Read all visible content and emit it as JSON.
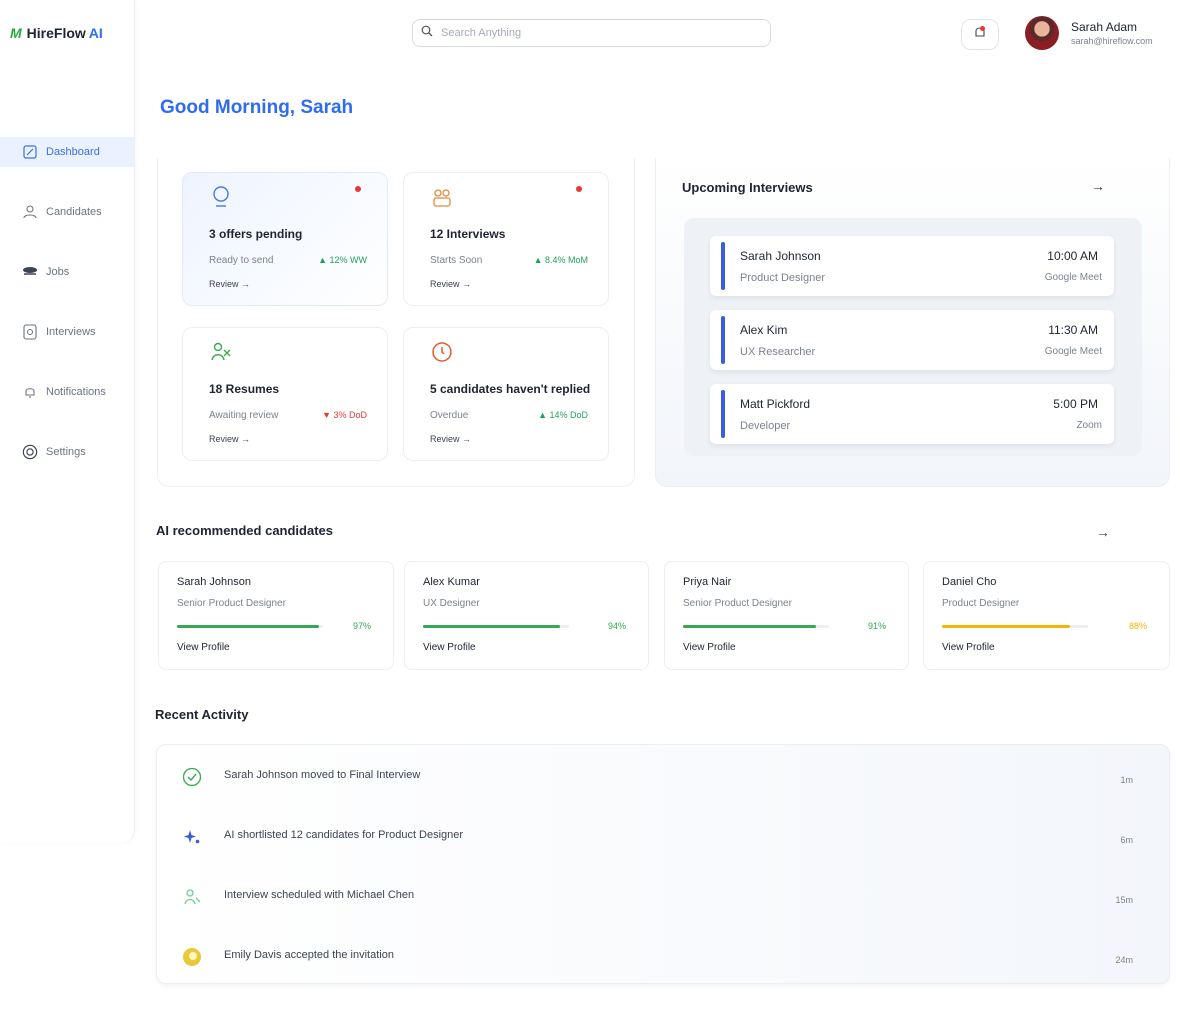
{
  "brand": {
    "mark": "M",
    "name": "HireFlow",
    "suffix": "AI"
  },
  "sidebar": {
    "items": [
      {
        "label": "Dashboard",
        "icon": "dashboard-icon",
        "active": true
      },
      {
        "label": "Candidates",
        "icon": "candidates-icon"
      },
      {
        "label": "Jobs",
        "icon": "jobs-icon"
      },
      {
        "label": "Interviews",
        "icon": "interviews-icon"
      },
      {
        "label": "Notifications",
        "icon": "bell-icon"
      },
      {
        "label": "Settings",
        "icon": "settings-icon"
      }
    ]
  },
  "header": {
    "search_placeholder": "Search Anything",
    "user": {
      "name": "Sarah Adam",
      "email": "sarah@hireflow.com"
    }
  },
  "greeting": "Good Morning, Sarah",
  "stats": [
    {
      "icon": "offer-icon",
      "title": "3 offers pending",
      "sub": "Ready to send",
      "delta": "▲ 12% WW",
      "negative": false,
      "link": "Review →",
      "alert": true
    },
    {
      "icon": "interview-people-icon",
      "title": "12 Interviews",
      "sub": "Starts Soon",
      "delta": "▲ 8.4% MoM",
      "negative": false,
      "link": "Review →",
      "alert": true
    },
    {
      "icon": "resume-icon",
      "title": "18 Resumes",
      "sub": "Awaiting review",
      "delta": "▼ 3% DoD",
      "negative": true,
      "link": "Review →",
      "alert": false
    },
    {
      "icon": "clock-icon",
      "title": "5 candidates haven't replied",
      "sub": "Overdue",
      "delta": "▲ 14% DoD",
      "negative": false,
      "link": "Review →",
      "alert": false
    }
  ],
  "interviews": {
    "title": "Upcoming Interviews",
    "arrow": "→",
    "items": [
      {
        "name": "Sarah Johnson",
        "role": "Product Designer",
        "time": "10:00 AM",
        "via": "Google Meet"
      },
      {
        "name": "Alex Kim",
        "role": "UX Researcher",
        "time": "11:30 AM",
        "via": "Google Meet"
      },
      {
        "name": "Matt Pickford",
        "role": "Developer",
        "time": "5:00 PM",
        "via": "Zoom"
      }
    ]
  },
  "recommended": {
    "title": "AI recommended candidates",
    "arrow": "→",
    "items": [
      {
        "name": "Sarah Johnson",
        "role": "Senior Product Designer",
        "score": 97,
        "pct": "97%",
        "color": "#34a853",
        "link": "View Profile"
      },
      {
        "name": "Alex Kumar",
        "role": "UX Designer",
        "score": 94,
        "pct": "94%",
        "color": "#34a853",
        "link": "View Profile"
      },
      {
        "name": "Priya Nair",
        "role": "Senior Product Designer",
        "score": 91,
        "pct": "91%",
        "color": "#34a853",
        "link": "View Profile"
      },
      {
        "name": "Daniel Cho",
        "role": "Product Designer",
        "score": 88,
        "pct": "88%",
        "color": "#f2b705",
        "link": "View Profile"
      }
    ]
  },
  "activity": {
    "title": "Recent Activity",
    "items": [
      {
        "icon": "check-circle-icon",
        "text": "Sarah Johnson moved to Final Interview",
        "time": "1m"
      },
      {
        "icon": "sparkle-icon",
        "text": "AI shortlisted 12 candidates for Product Designer",
        "time": "6m"
      },
      {
        "icon": "calendar-icon",
        "text": "Interview scheduled with Michael Chen",
        "time": "15m"
      },
      {
        "icon": "accepted-icon",
        "text": "Emily Davis accepted the invitation",
        "time": "24m"
      }
    ]
  },
  "colors": {
    "accent": "#2f6cf0",
    "brand_green": "#27a844",
    "interview_bar": "#3b5be0",
    "alert": "#e53935"
  }
}
